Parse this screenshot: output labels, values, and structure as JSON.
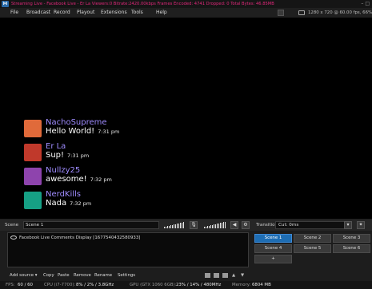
{
  "titlebar": {
    "title": "Streaming Live - Facebook Live - Er La  Viewers:0  Bitrate:2420.00kbps  Frames Encoded: 4741  Dropped: 0  Total Bytes: 46.85MB",
    "window_controls": "–  □"
  },
  "menu": [
    "File",
    "Broadcast",
    "Record",
    "Playout",
    "Extensions",
    "Tools",
    "Help"
  ],
  "menu_status": "1280 x 720 @ 60.00 fps, 66%",
  "comments": [
    {
      "name": "NachoSupreme",
      "message": "Hello World!",
      "time": "7:31 pm",
      "avatar_color": "#e06a3a"
    },
    {
      "name": "Er La",
      "message": "Sup!",
      "time": "7:31 pm",
      "avatar_color": "#c0392b"
    },
    {
      "name": "Nullzy25",
      "message": "awesome!",
      "time": "7:32 pm",
      "avatar_color": "#8e44ad"
    },
    {
      "name": "NerdKills",
      "message": "Nada",
      "time": "7:32 pm",
      "avatar_color": "#16a085"
    }
  ],
  "scene": {
    "label": "Scene",
    "value": "Scene 1"
  },
  "transition": {
    "label": "Transition",
    "value": "Cut: 0ms"
  },
  "sources": [
    {
      "label": "Facebook Live Comments Display [1677540432580933]"
    }
  ],
  "scene_buttons": [
    {
      "label": "Scene 1",
      "active": true
    },
    {
      "label": "Scene 2",
      "active": false
    },
    {
      "label": "Scene 3",
      "active": false
    },
    {
      "label": "Scene 4",
      "active": false
    },
    {
      "label": "Scene 5",
      "active": false
    },
    {
      "label": "Scene 6",
      "active": false
    },
    {
      "label": "+",
      "active": false
    }
  ],
  "toolbar": {
    "add_source": "Add source ▾",
    "copy": "Copy",
    "paste": "Paste",
    "remove": "Remove",
    "rename": "Rename",
    "settings": "Settings"
  },
  "status": {
    "fps_label": "FPS:",
    "fps_value": "60 / 60",
    "cpu_label": "CPU (i7-7700):",
    "cpu_value": "8% / 2% / 3.8GHz",
    "gpu_label": "GPU (GTX 1060 6GB):",
    "gpu_value": "23% / 14% / 480MHz",
    "mem_label": "Memory:",
    "mem_value": "6804 MB"
  },
  "accent_color": "#1e6db3",
  "title_color": "#e0287a",
  "name_color": "#9f8cff"
}
